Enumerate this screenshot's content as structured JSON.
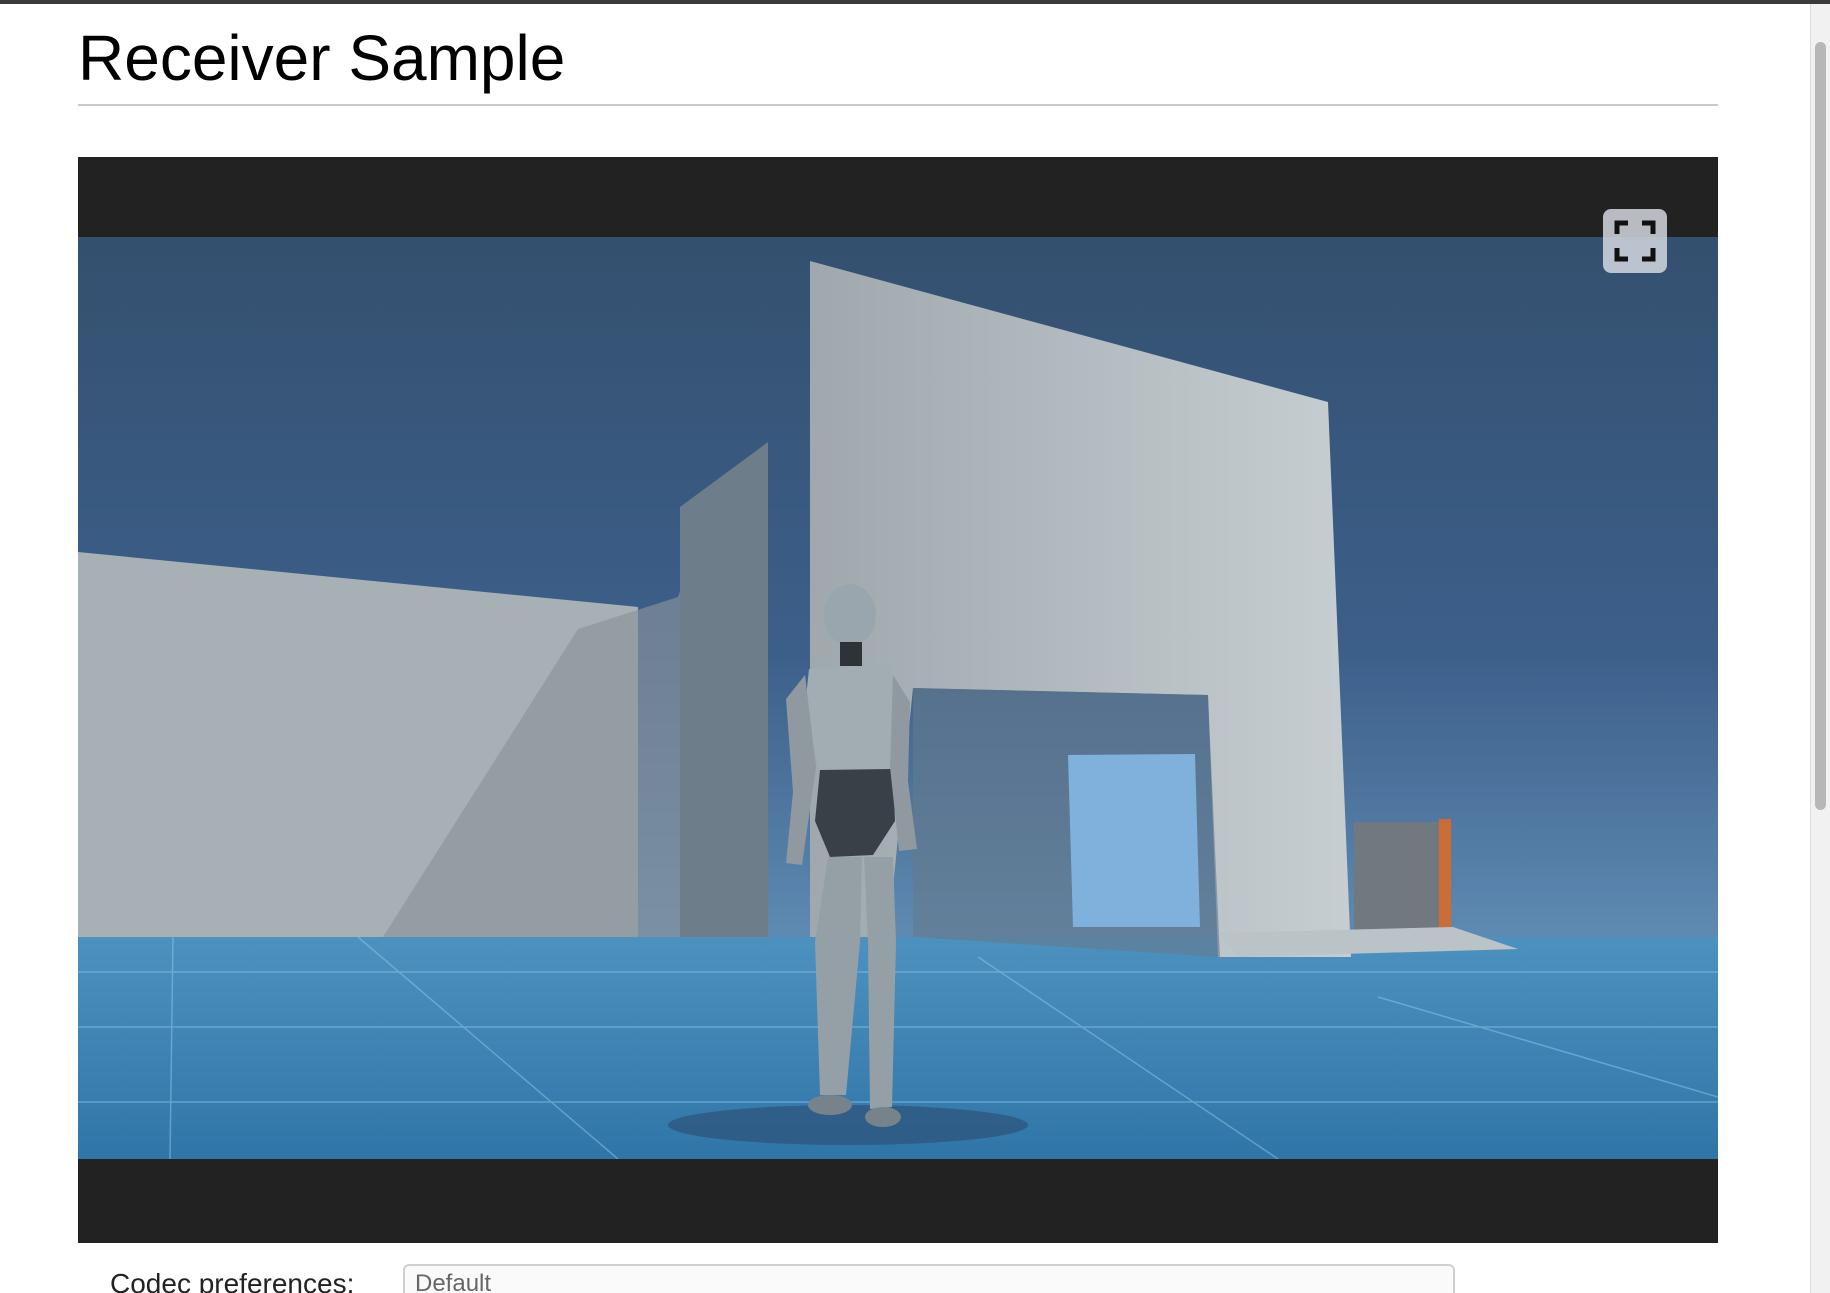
{
  "page": {
    "title": "Receiver Sample"
  },
  "video": {
    "fullscreen_icon": "fullscreen-icon"
  },
  "settings": {
    "codec_label": "Codec preferences:",
    "codec_value": "Default"
  },
  "colors": {
    "player_background": "#222222",
    "sky_top": "#355277",
    "sky_bottom": "#6c9bc3",
    "ground": "#3f82b1",
    "wall": "#b6bec2"
  }
}
